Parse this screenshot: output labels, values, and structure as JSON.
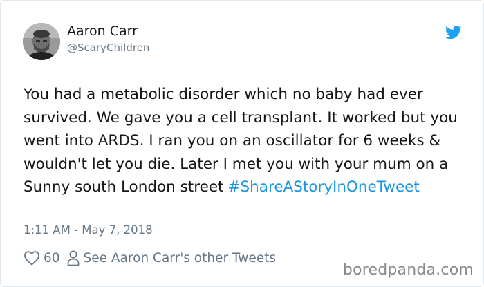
{
  "author": {
    "name": "Aaron Carr",
    "handle": "@ScaryChildren"
  },
  "tweet": {
    "text": "You had a metabolic disorder which no baby had ever survived. We gave you a cell transplant. It worked but you went into ARDS. I ran you on an oscillator for 6 weeks & wouldn't let you die. Later I met you with your mum on a Sunny south London street",
    "hashtag": "#ShareAStoryInOneTweet",
    "timestamp": "1:11 AM - May 7, 2018"
  },
  "actions": {
    "like_count": "60",
    "other_tweets_label": "See Aaron Carr's other Tweets"
  },
  "icons": {
    "brand": "twitter-bird-icon",
    "like": "heart-icon",
    "profile": "person-icon"
  },
  "colors": {
    "twitter_blue": "#1da1f2",
    "hashtag": "#1b95e0",
    "secondary_text": "#657786",
    "primary_text": "#14171a"
  },
  "watermark": "boredpanda.com"
}
